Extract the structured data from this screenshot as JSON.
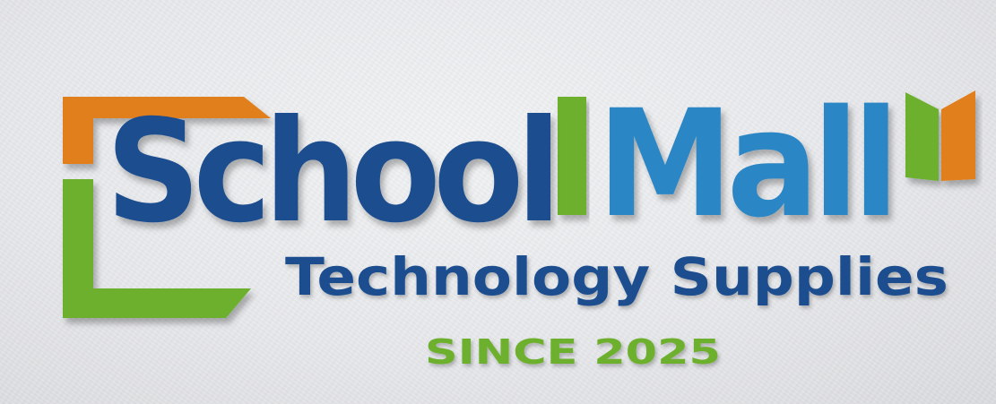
{
  "logo": {
    "school": "School",
    "mall": "Mall",
    "tagline": "Technology Supplies",
    "since": "SINCE  2025"
  },
  "colors": {
    "orange": "#e07f1f",
    "green": "#6cb02e",
    "dark_blue": "#1d4e8f",
    "light_blue": "#2a86c4",
    "background": "#e8e9ec"
  }
}
